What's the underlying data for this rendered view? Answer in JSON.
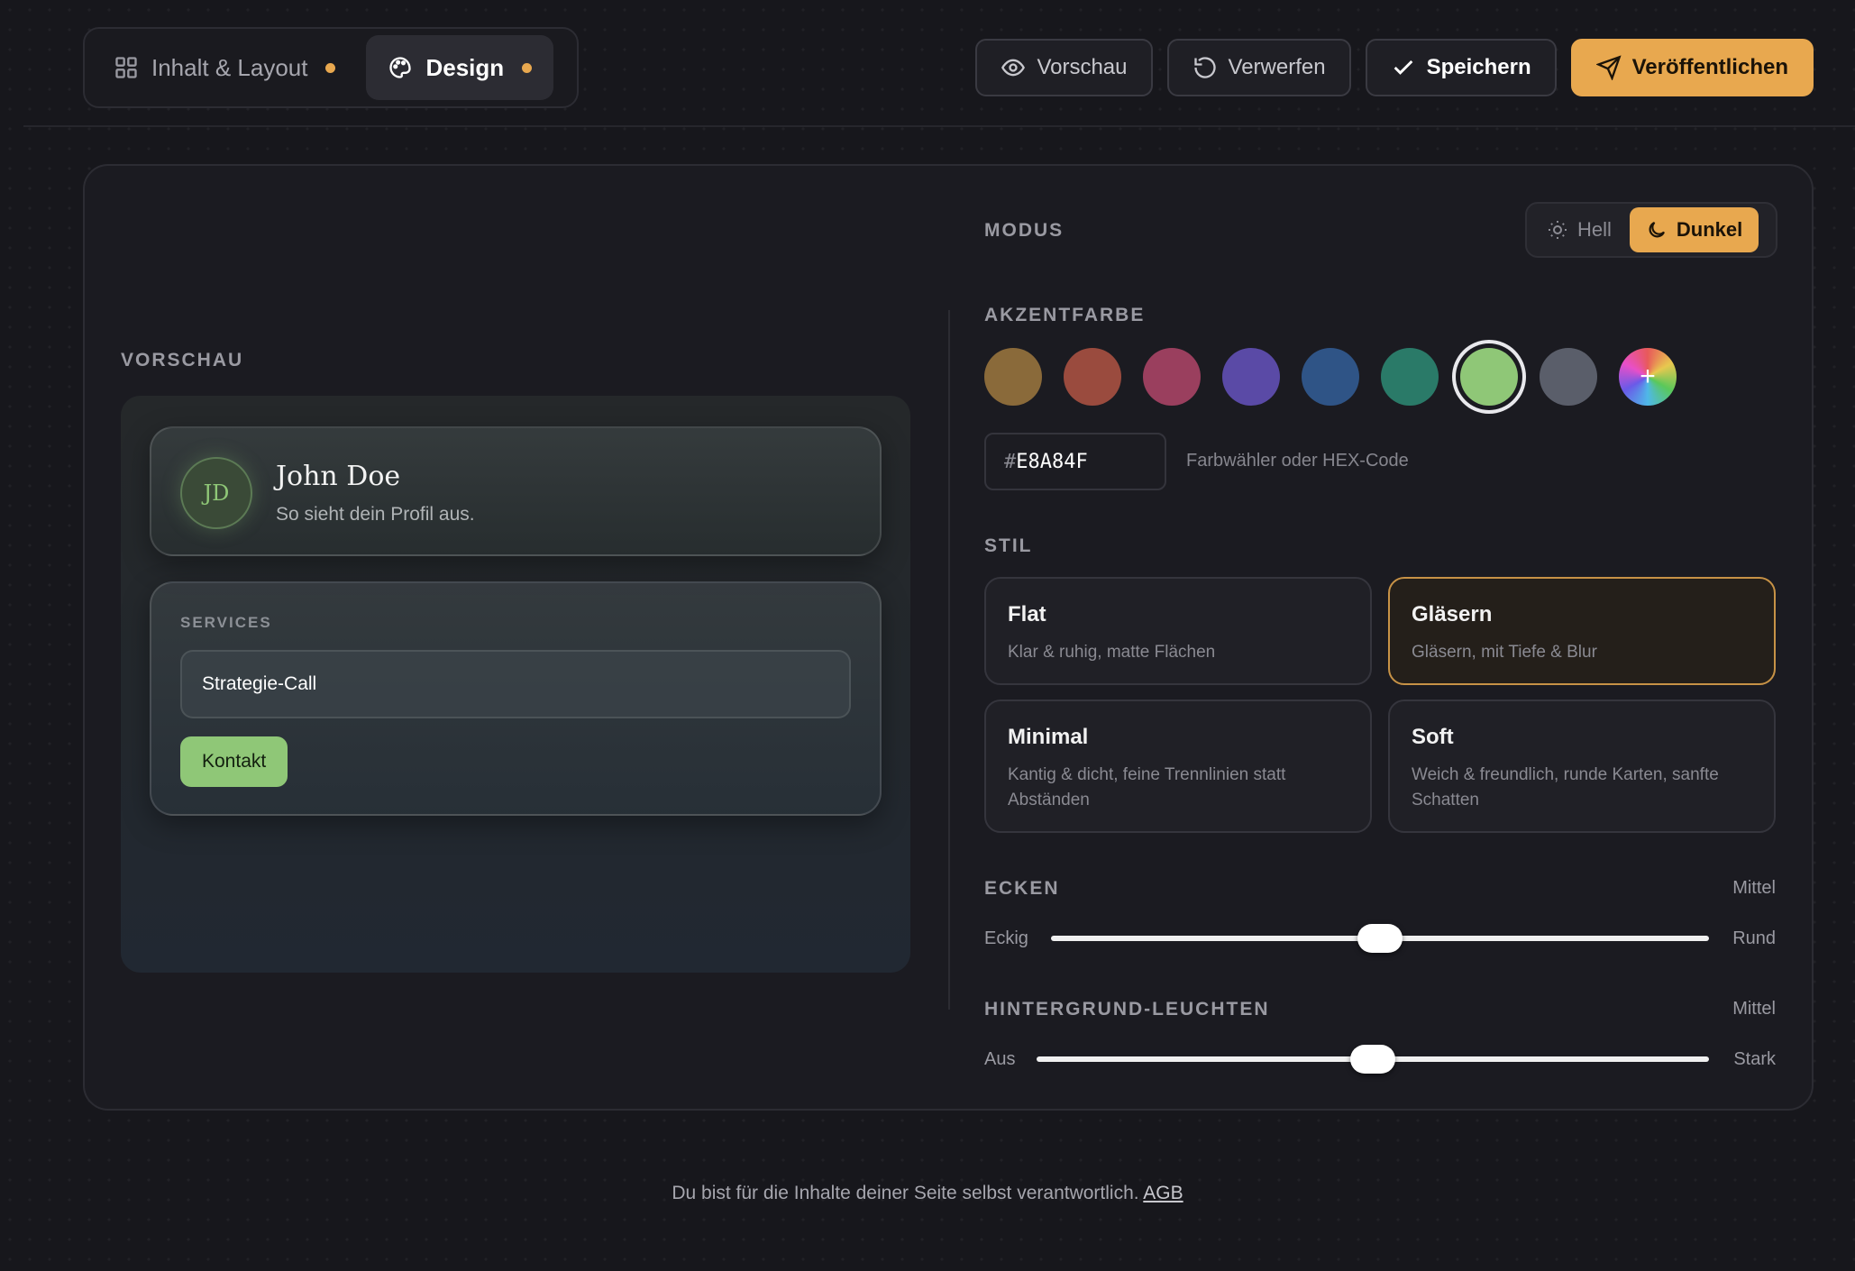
{
  "tabs": [
    {
      "label": "Inhalt & Layout",
      "icon": "grid-icon",
      "active": false
    },
    {
      "label": "Design",
      "icon": "palette-icon",
      "active": true
    }
  ],
  "actions": {
    "preview": "Vorschau",
    "discard": "Verwerfen",
    "save": "Speichern",
    "publish": "Veröffentlichen"
  },
  "preview": {
    "section_label": "VORSCHAU",
    "profile": {
      "initials": "JD",
      "name": "John Doe",
      "subtitle": "So sieht dein Profil aus."
    },
    "services": {
      "label": "SERVICES",
      "item": "Strategie-Call",
      "button": "Kontakt"
    }
  },
  "mode": {
    "label": "MODUS",
    "light": "Hell",
    "dark": "Dunkel",
    "selected": "dark"
  },
  "accent": {
    "label": "AKZENTFARBE",
    "swatches": [
      "#8a6a3a",
      "#9a4b3e",
      "#9a3f5e",
      "#5a4aa6",
      "#2f5486",
      "#2a7a68",
      "#8fc777",
      "#5a5e6a"
    ],
    "selected_index": 6,
    "hex_prefix": "#",
    "hex_value": "E8A84F",
    "hint": "Farbwähler oder HEX-Code"
  },
  "style": {
    "label": "STIL",
    "options": [
      {
        "title": "Flat",
        "desc": "Klar & ruhig, matte Flächen"
      },
      {
        "title": "Gläsern",
        "desc": "Gläsern, mit Tiefe & Blur"
      },
      {
        "title": "Minimal",
        "desc": "Kantig & dicht, feine Trennlinien statt Abständen"
      },
      {
        "title": "Soft",
        "desc": "Weich & freundlich, runde Karten, sanfte Schatten"
      }
    ],
    "selected_index": 1
  },
  "corners": {
    "label": "ECKEN",
    "value_text": "Mittel",
    "min_label": "Eckig",
    "max_label": "Rund",
    "value": 0.5
  },
  "glow": {
    "label": "HINTERGRUND-LEUCHTEN",
    "value_text": "Mittel",
    "min_label": "Aus",
    "max_label": "Stark",
    "value": 0.5
  },
  "footer": {
    "text": "Du bist für die Inhalte deiner Seite selbst verantwortlich.",
    "link": "AGB"
  },
  "colors": {
    "accent": "#e8a84f",
    "service_button": "#8fc777"
  }
}
